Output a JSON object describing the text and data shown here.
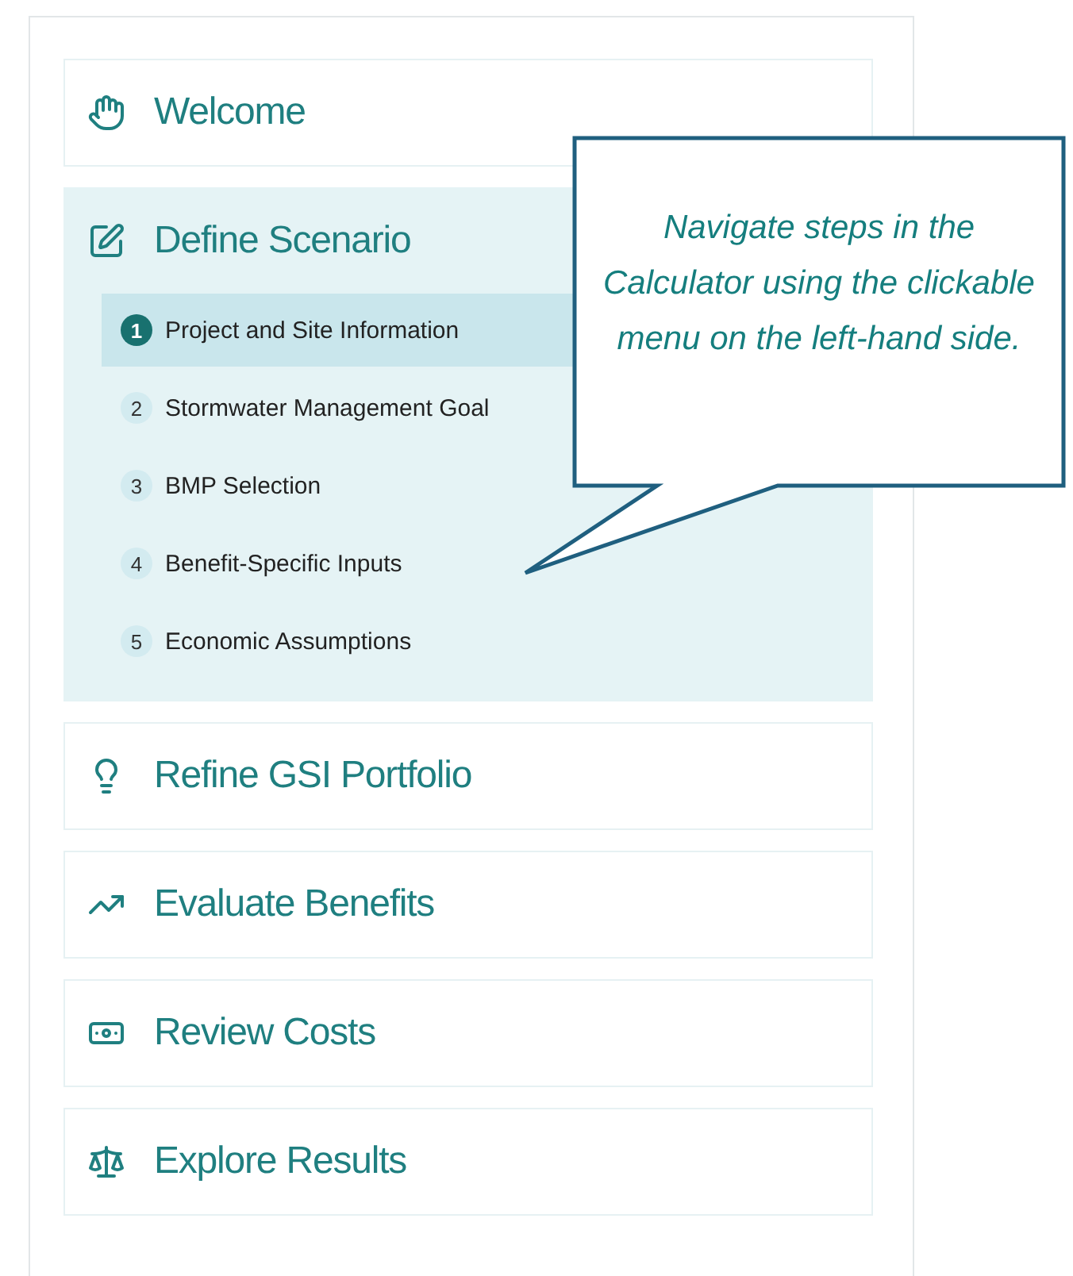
{
  "sections": [
    {
      "label": "Welcome",
      "expanded": false
    },
    {
      "label": "Define Scenario",
      "expanded": true,
      "steps": [
        {
          "number": "1",
          "label": "Project and Site Information",
          "selected": true
        },
        {
          "number": "2",
          "label": "Stormwater Management Goal",
          "selected": false
        },
        {
          "number": "3",
          "label": "BMP Selection",
          "selected": false
        },
        {
          "number": "4",
          "label": "Benefit-Specific Inputs",
          "selected": false
        },
        {
          "number": "5",
          "label": "Economic Assumptions",
          "selected": false
        }
      ]
    },
    {
      "label": "Refine GSI Portfolio",
      "expanded": false
    },
    {
      "label": "Evaluate Benefits",
      "expanded": false
    },
    {
      "label": "Review Costs",
      "expanded": false
    },
    {
      "label": "Explore Results",
      "expanded": false
    }
  ],
  "callout": {
    "text": "Navigate steps in the Calculator using the clickable menu on the left-hand side."
  }
}
